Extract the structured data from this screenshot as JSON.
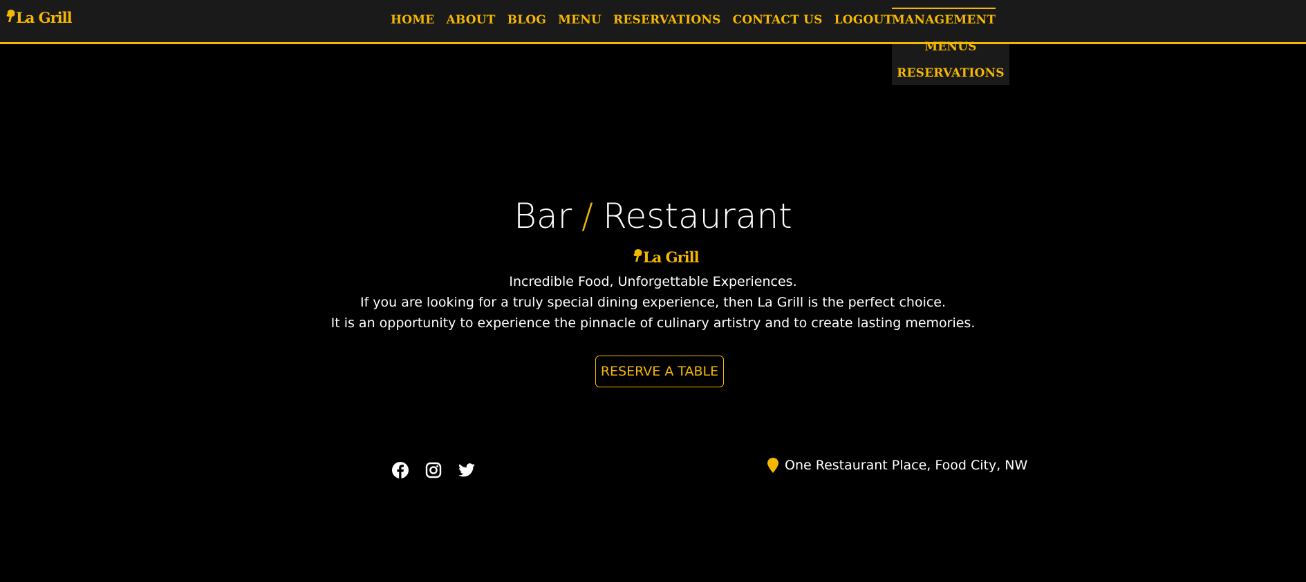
{
  "brand": {
    "name": "La Grill",
    "accent_color": "#f5b800"
  },
  "nav": {
    "items": [
      {
        "label": "HOME"
      },
      {
        "label": "ABOUT"
      },
      {
        "label": "BLOG"
      },
      {
        "label": "MENU"
      },
      {
        "label": "RESERVATIONS"
      },
      {
        "label": "CONTACT US"
      },
      {
        "label": "LOGOUT"
      }
    ],
    "management": {
      "label": "MANAGEMENT",
      "items": [
        {
          "label": "MENUS"
        },
        {
          "label": "RESERVATIONS"
        }
      ]
    }
  },
  "hero": {
    "title_left": "Bar",
    "title_sep": "/",
    "title_right": "Restaurant",
    "logo_text": "La Grill",
    "lines": [
      "Incredible Food, Unforgettable Experiences.",
      "If you are looking for a truly special dining experience, then La Grill is the perfect choice.",
      "It is an opportunity to experience the pinnacle of culinary artistry and to create lasting memories."
    ],
    "button_label": "RESERVE A TABLE"
  },
  "footer": {
    "social": [
      {
        "icon": "facebook-icon"
      },
      {
        "icon": "instagram-icon"
      },
      {
        "icon": "twitter-icon"
      }
    ],
    "address_icon": "map-pin-icon",
    "address": "One Restaurant Place, Food City, NW"
  }
}
